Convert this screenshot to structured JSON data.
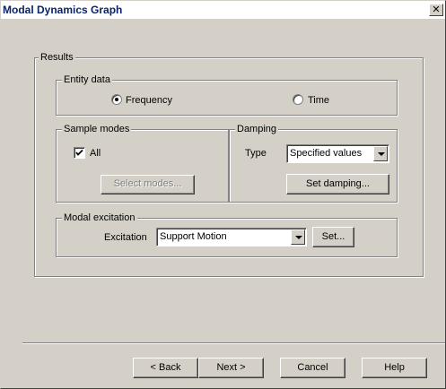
{
  "window": {
    "title": "Modal Dynamics Graph"
  },
  "results": {
    "legend": "Results",
    "entity_data": {
      "legend": "Entity data",
      "frequency_label": "Frequency",
      "time_label": "Time",
      "selected": "Frequency"
    },
    "sample_modes": {
      "legend": "Sample modes",
      "all_label": "All",
      "all_checked": true,
      "select_modes_label": "Select modes..."
    },
    "damping": {
      "legend": "Damping",
      "type_label": "Type",
      "type_value": "Specified values",
      "set_damping_label": "Set damping..."
    },
    "modal_excitation": {
      "legend": "Modal excitation",
      "excitation_label": "Excitation",
      "excitation_value": "Support Motion",
      "set_label": "Set..."
    }
  },
  "footer": {
    "back_label": "< Back",
    "next_label": "Next >",
    "cancel_label": "Cancel",
    "help_label": "Help"
  },
  "icons": {
    "close": "close-icon",
    "checkmark": "checkmark-icon",
    "dropdown": "chevron-down-icon"
  }
}
